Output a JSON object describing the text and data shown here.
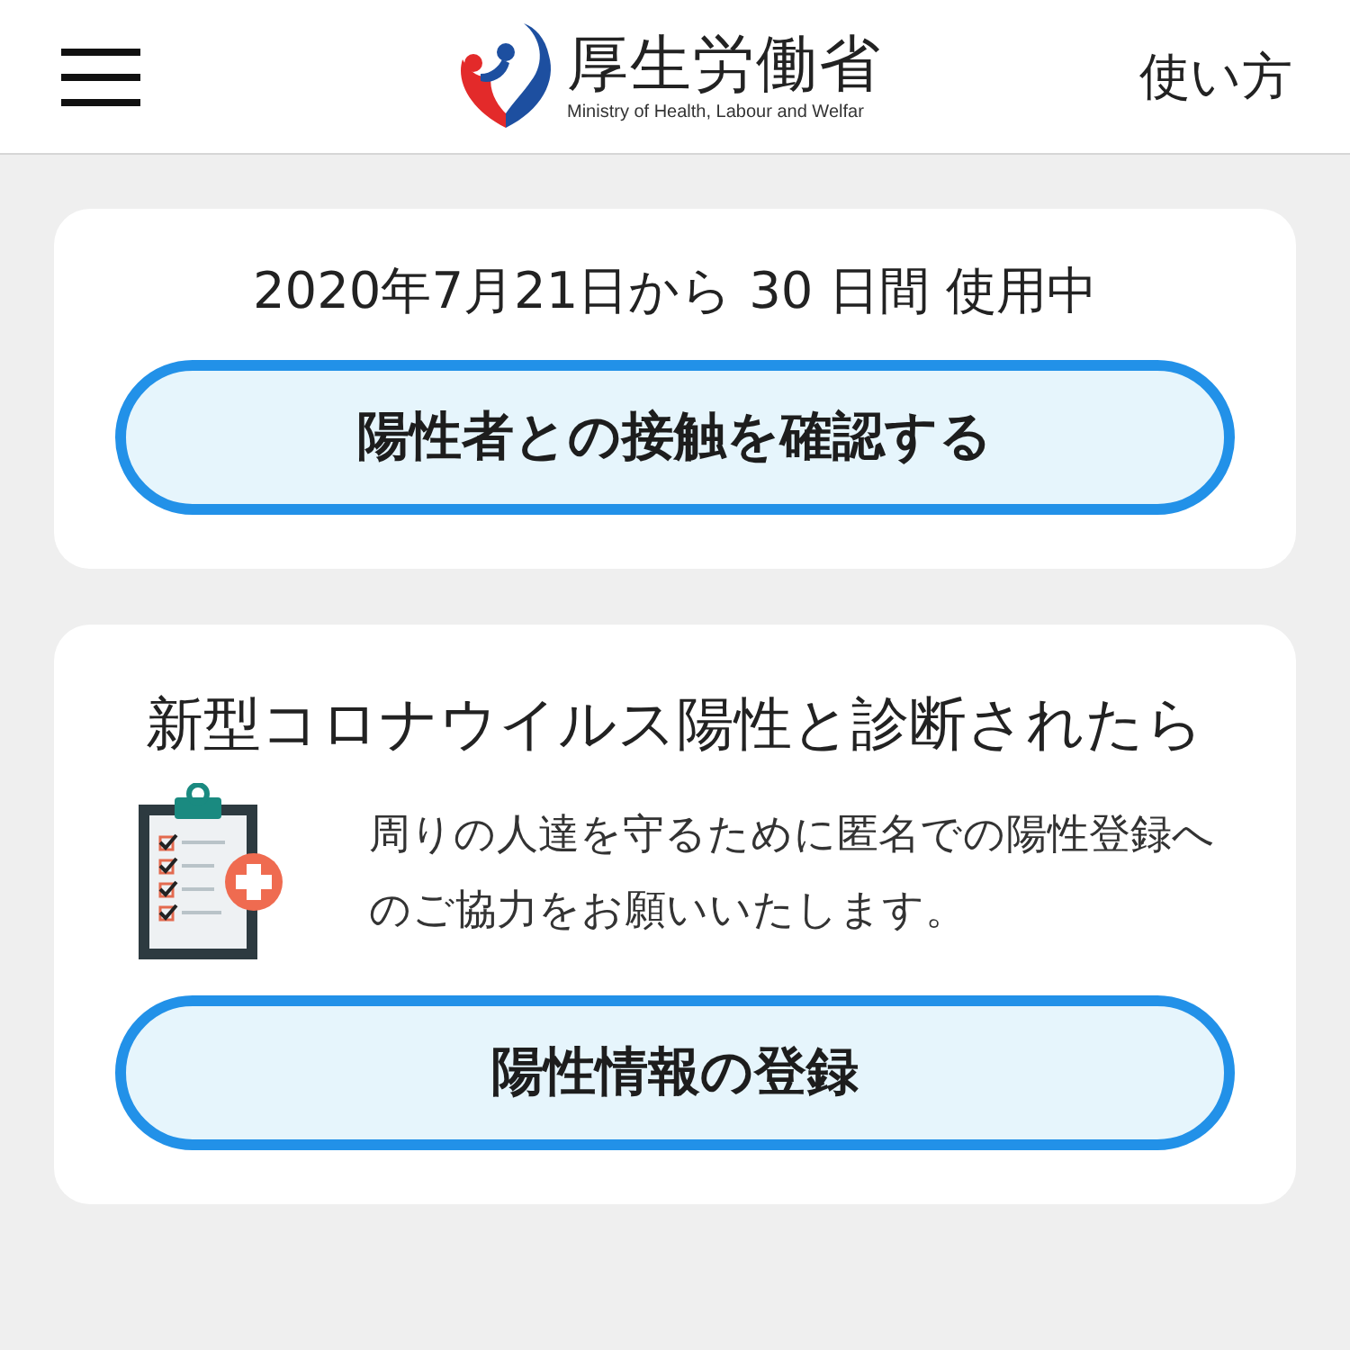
{
  "header": {
    "logo_title": "厚生労働省",
    "logo_subtitle": "Ministry of Health, Labour and Welfar",
    "help_link": "使い方"
  },
  "usage_card": {
    "status": "2020年7月21日から 30 日間 使用中",
    "button": "陽性者との接触を確認する"
  },
  "positive_card": {
    "title": "新型コロナウイルス陽性と診断されたら",
    "message": "周りの人達を守るために匿名での陽性登録へのご協力をお願いいたします。",
    "button": "陽性情報の登録"
  }
}
